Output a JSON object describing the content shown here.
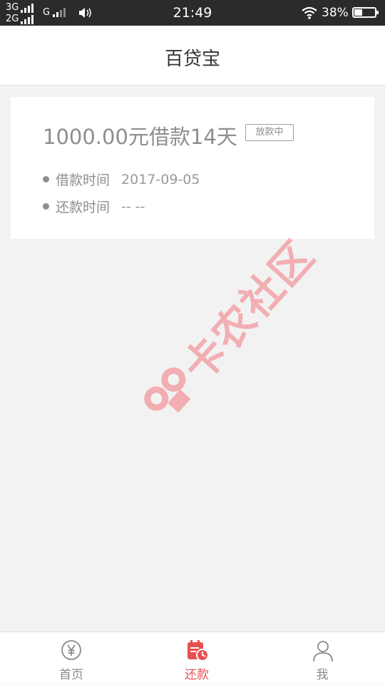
{
  "status_bar": {
    "network_top": "3G",
    "network_bottom": "2G",
    "network_g": "G",
    "time": "21:49",
    "battery_percent_text": "38%",
    "battery_level": 0.38
  },
  "header": {
    "title": "百贷宝"
  },
  "loan": {
    "title": "1000.00元借款14天",
    "status": "放款中",
    "rows": [
      {
        "label": "借款时间",
        "value": "2017-09-05"
      },
      {
        "label": "还款时间",
        "value": "-- --"
      }
    ]
  },
  "watermark": {
    "text": "卡农社区"
  },
  "tab_bar": {
    "accent_color": "#e85050",
    "tabs": [
      {
        "label": "首页",
        "icon": "yen-circle-icon",
        "active": false
      },
      {
        "label": "还款",
        "icon": "calendar-clock-icon",
        "active": true
      },
      {
        "label": "我",
        "icon": "user-icon",
        "active": false
      }
    ]
  }
}
